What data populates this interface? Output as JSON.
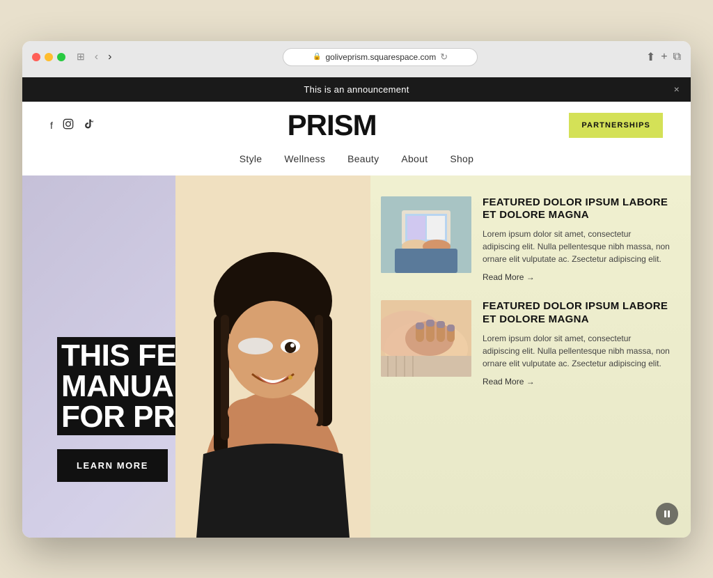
{
  "browser": {
    "url": "goliveprism.squarespace.com",
    "back_btn": "‹",
    "forward_btn": "›",
    "refresh": "↻",
    "share": "⬆",
    "new_tab": "+",
    "windows": "⧉"
  },
  "announcement": {
    "text": "This is an announcement",
    "close": "×"
  },
  "header": {
    "logo": "PRISM",
    "partnerships_label": "PARTNERSHIPS",
    "social": {
      "facebook": "f",
      "instagram": "🔘",
      "tiktok": "♪"
    }
  },
  "nav": {
    "items": [
      "Style",
      "Wellness",
      "Beauty",
      "About",
      "Shop"
    ]
  },
  "hero": {
    "headline": "THIS FEATURE IS MANUALLY SET FOR PROMOTION",
    "cta_label": "LEARN MORE"
  },
  "articles": [
    {
      "title": "FEATURED DOLOR IPSUM LABORE ET DOLORE MAGNA",
      "excerpt": "Lorem ipsum dolor sit amet, consectetur adipiscing elit. Nulla pellentesque nibh massa, non ornare elit vulputate ac. Zsectetur adipiscing elit.",
      "read_more": "Read More"
    },
    {
      "title": "FEATURED DOLOR IPSUM LABORE ET DOLORE MAGNA",
      "excerpt": "Lorem ipsum dolor sit amet, consectetur adipiscing elit. Nulla pellentesque nibh massa, non ornare elit vulputate ac. Zsectetur adipiscing elit.",
      "read_more": "Read More"
    }
  ],
  "colors": {
    "accent_yellow": "#d4e157",
    "dark": "#111111",
    "hero_bg": "#c5c0d8",
    "featured_bg": "#f5f5dc"
  }
}
